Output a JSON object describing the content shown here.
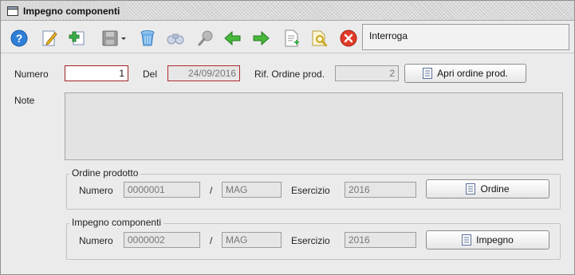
{
  "window": {
    "title": "Impegno componenti"
  },
  "toolbar": {
    "buttons": [
      {
        "name": "help-icon"
      },
      {
        "name": "edit-icon"
      },
      {
        "name": "add-icon"
      },
      {
        "name": "save-icon"
      },
      {
        "name": "delete-icon"
      },
      {
        "name": "binoculars-icon"
      },
      {
        "name": "search-icon"
      },
      {
        "name": "arrow-left-icon"
      },
      {
        "name": "arrow-right-icon"
      },
      {
        "name": "new-document-icon"
      },
      {
        "name": "find-document-icon"
      },
      {
        "name": "close-icon"
      }
    ],
    "mode": "Interroga"
  },
  "header": {
    "numero_label": "Numero",
    "numero_value": "1",
    "del_label": "Del",
    "del_value": "24/09/2016",
    "rif_label": "Rif. Ordine prod.",
    "rif_value": "2",
    "apri_button": "Apri ordine prod."
  },
  "note": {
    "label": "Note",
    "value": ""
  },
  "ordine_prodotto": {
    "title": "Ordine prodotto",
    "numero_label": "Numero",
    "numero_value": "0000001",
    "slash": "/",
    "series_value": "MAG",
    "esercizio_label": "Esercizio",
    "esercizio_value": "2016",
    "button": "Ordine"
  },
  "impegno_componenti": {
    "title": "Impegno componenti",
    "numero_label": "Numero",
    "numero_value": "0000002",
    "slash": "/",
    "series_value": "MAG",
    "esercizio_label": "Esercizio",
    "esercizio_value": "2016",
    "button": "Impegno"
  },
  "colors": {
    "accent_red": "#b02a2a",
    "window_bg": "#ebebeb"
  }
}
